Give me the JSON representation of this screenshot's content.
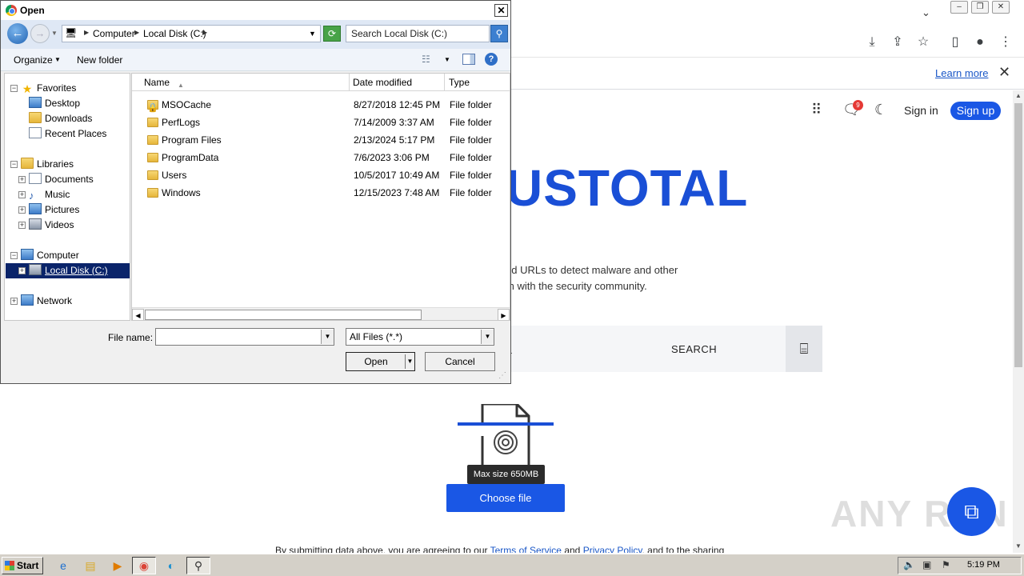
{
  "browser": {
    "tab_dropdown_icon": "chevron-down-icon",
    "window_controls": [
      "minimize",
      "restore",
      "close"
    ],
    "learn_more": "Learn more"
  },
  "vt": {
    "signin": "Sign in",
    "signup": "Sign up",
    "notification_count": "9",
    "logo_text": "USTOTAL",
    "desc_line1": "nd URLs to detect malware and other",
    "desc_line2": "m with the security community.",
    "search_label": "SEARCH",
    "search_dash": "-",
    "tooltip": "Max size 650MB",
    "choose_file": "Choose file",
    "agree_prefix": "By submitting data above, you are agreeing to our",
    "terms": "Terms of Service",
    "and": "and",
    "privacy": "Privacy Policy",
    "agree_suffix": ", and to the sharing",
    "watermark": "ANY RUN",
    "brand_color": "#1a57e5"
  },
  "dialog": {
    "title": "Open",
    "breadcrumb": [
      "Computer",
      "Local Disk (C:)"
    ],
    "search_placeholder": "Search Local Disk (C:)",
    "organize": "Organize",
    "new_folder": "New folder",
    "nav": {
      "favorites": "Favorites",
      "desktop": "Desktop",
      "downloads": "Downloads",
      "recent_places": "Recent Places",
      "libraries": "Libraries",
      "documents": "Documents",
      "music": "Music",
      "pictures": "Pictures",
      "videos": "Videos",
      "computer": "Computer",
      "local_disk": "Local Disk (C:)",
      "network": "Network"
    },
    "columns": {
      "name": "Name",
      "date": "Date modified",
      "type": "Type"
    },
    "files": [
      {
        "name": "MSOCache",
        "date": "8/27/2018 12:45 PM",
        "type": "File folder"
      },
      {
        "name": "PerfLogs",
        "date": "7/14/2009 3:37 AM",
        "type": "File folder"
      },
      {
        "name": "Program Files",
        "date": "2/13/2024 5:17 PM",
        "type": "File folder"
      },
      {
        "name": "ProgramData",
        "date": "7/6/2023 3:06 PM",
        "type": "File folder"
      },
      {
        "name": "Users",
        "date": "10/5/2017 10:49 AM",
        "type": "File folder"
      },
      {
        "name": "Windows",
        "date": "12/15/2023 7:48 AM",
        "type": "File folder"
      }
    ],
    "file_name_label": "File name:",
    "file_name_value": "",
    "file_type": "All Files (*.*)",
    "open": "Open",
    "cancel": "Cancel"
  },
  "taskbar": {
    "start": "Start",
    "clock": "5:19 PM"
  }
}
